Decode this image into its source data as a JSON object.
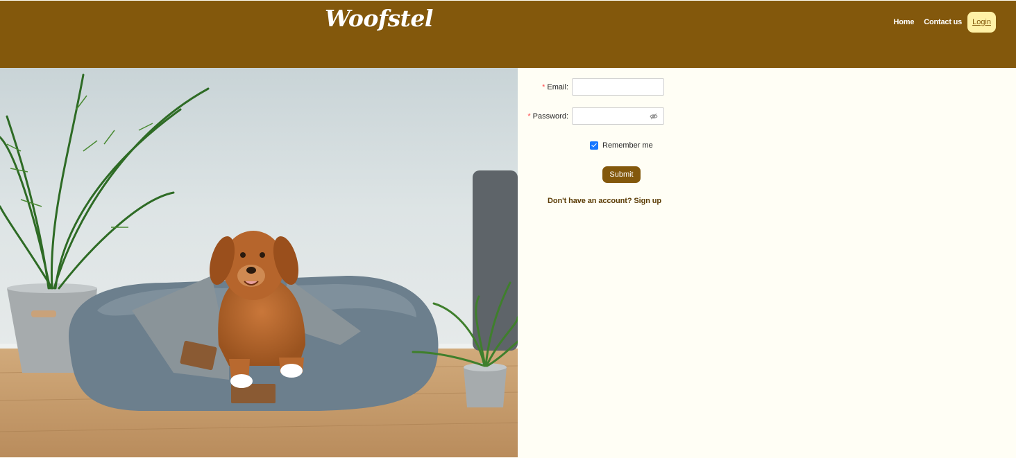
{
  "header": {
    "logo": "Woofstel",
    "nav": {
      "home": "Home",
      "contact": "Contact us",
      "login": "Login"
    },
    "colors": {
      "bar": "#83580c",
      "login_bg": "#fff1a6"
    }
  },
  "hero": {
    "image_alt": "Dog lying in a grey pet bed between two potted plants"
  },
  "form": {
    "email_label": "Email",
    "password_label": "Password",
    "colon": ":",
    "required_mark": "*",
    "email_value": "",
    "password_value": "",
    "remember_label": "Remember me",
    "remember_checked": true,
    "submit_label": "Submit",
    "signup_prompt": "Don't have an account? ",
    "signup_link": "Sign up"
  }
}
